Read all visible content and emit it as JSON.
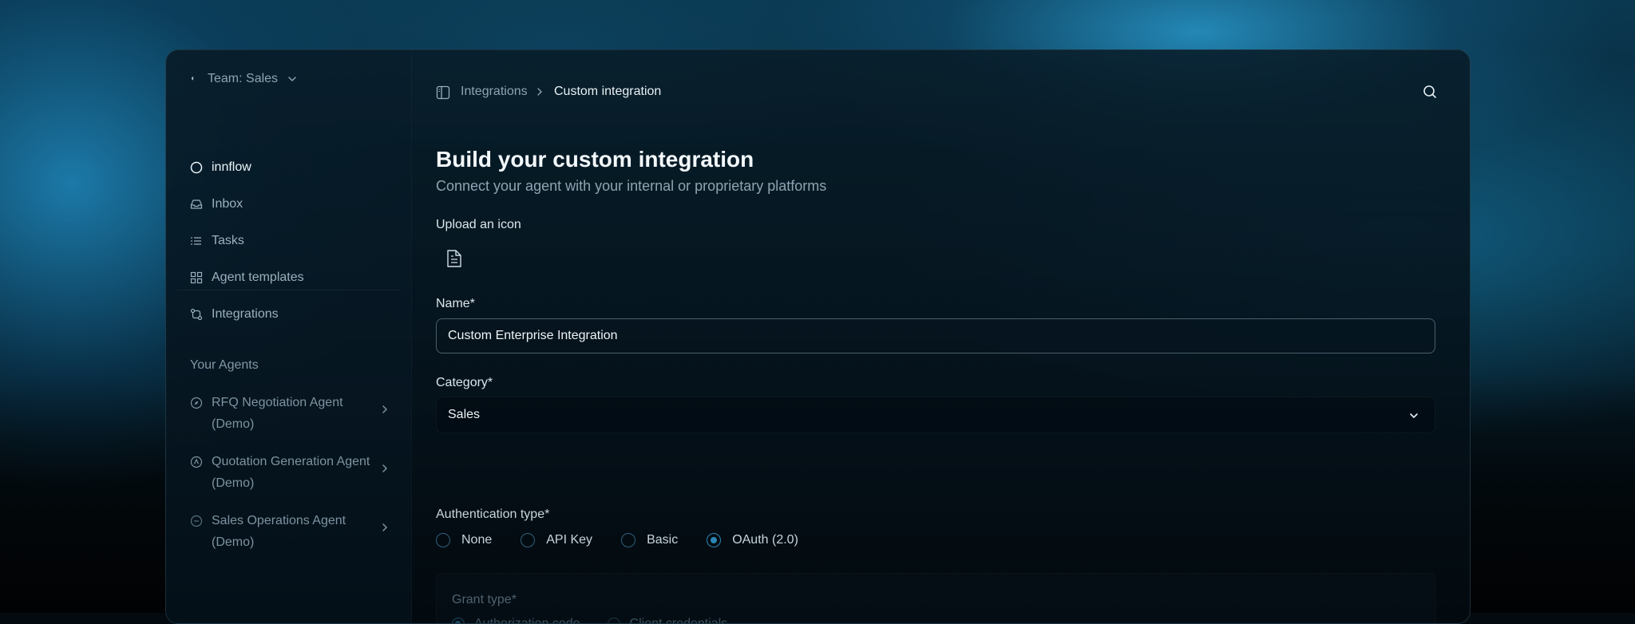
{
  "sidebar": {
    "team_label": "Team: Sales",
    "nav": [
      {
        "label": "innflow",
        "icon": "circle-icon",
        "active": true
      },
      {
        "label": "Inbox",
        "icon": "inbox-icon"
      },
      {
        "label": "Tasks",
        "icon": "list-icon"
      },
      {
        "label": "Agent templates",
        "icon": "grid-icon"
      },
      {
        "label": "Integrations",
        "icon": "git-compare-icon"
      }
    ],
    "agents_section": "Your Agents",
    "agents": [
      {
        "name": "RFQ Negotiation Agent (Demo)",
        "icon": "compass-icon"
      },
      {
        "name": "Quotation Generation Agent (Demo)",
        "icon": "badge-icon"
      },
      {
        "name": "Sales Operations Agent (Demo)",
        "icon": "dashed-circle-icon"
      }
    ]
  },
  "breadcrumb": {
    "parent": "Integrations",
    "current": "Custom integration"
  },
  "page": {
    "title": "Build your custom integration",
    "subtitle": "Connect your agent with your internal or proprietary platforms"
  },
  "form": {
    "upload_label": "Upload an icon",
    "name_label": "Name*",
    "name_value": "Custom Enterprise Integration",
    "category_label": "Category*",
    "category_value": "Sales",
    "auth_label": "Authentication type*",
    "auth_options": [
      "None",
      "API Key",
      "Basic",
      "OAuth (2.0)"
    ],
    "auth_selected": "OAuth (2.0)",
    "grant_label": "Grant type*",
    "grant_options": [
      "Authorization code",
      "Client credentials"
    ],
    "grant_selected": "Authorization code"
  },
  "colors": {
    "accent": "#2a86b5",
    "background": "#062030"
  }
}
